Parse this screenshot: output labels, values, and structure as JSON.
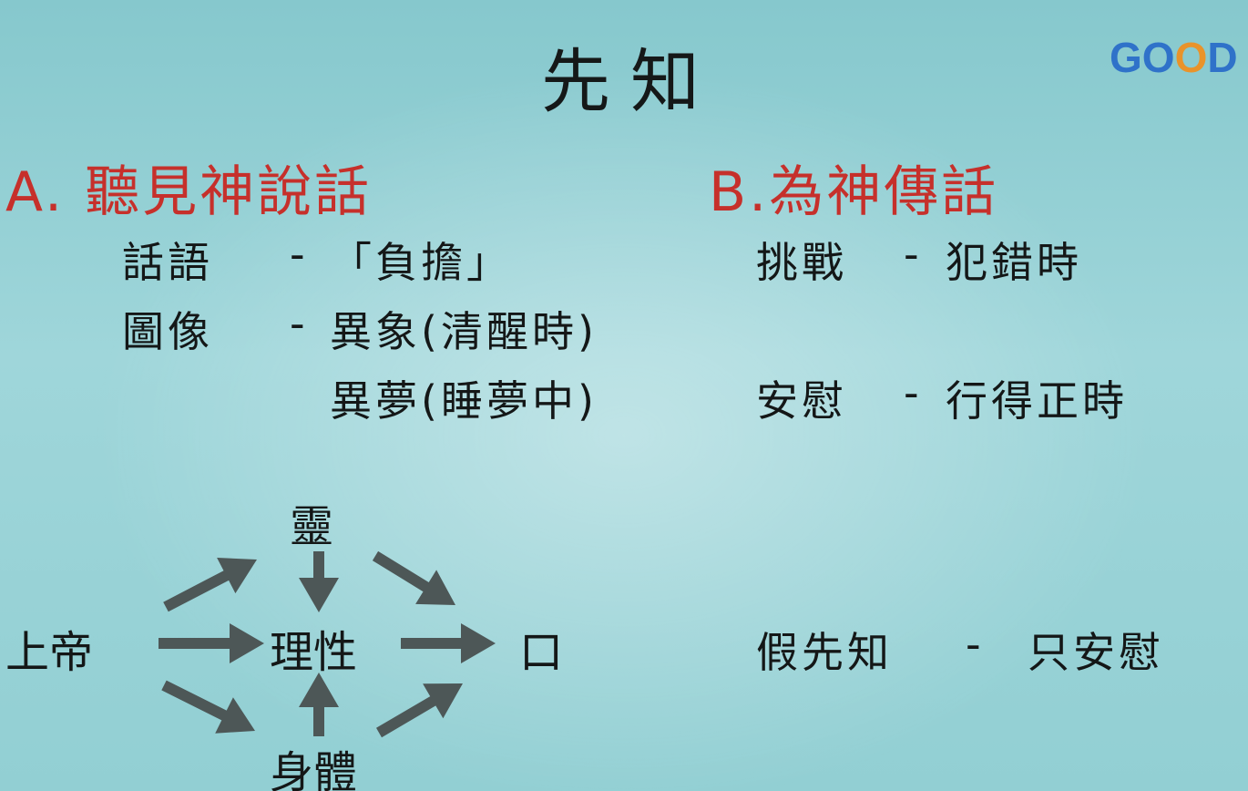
{
  "slide": {
    "title": "先知",
    "logo": {
      "g": "G",
      "o1": "O",
      "o2": "O",
      "d": "D"
    },
    "section_a": {
      "heading": "A. 聽見神說話",
      "row1": {
        "term": "話語",
        "dash": "-",
        "desc": "「負擔」"
      },
      "row2": {
        "term": "圖像",
        "dash": "-",
        "desc": "異象(清醒時)"
      },
      "row3": {
        "desc": "異夢(睡夢中)"
      }
    },
    "section_b": {
      "heading": "B.為神傳話",
      "row1": {
        "term": "挑戰",
        "dash": "-",
        "desc": "犯錯時"
      },
      "row2": {
        "term": "安慰",
        "dash": "-",
        "desc": "行得正時"
      },
      "row3": {
        "term": "假先知",
        "dash": "-",
        "desc": "只安慰"
      }
    },
    "diagram": {
      "spirit": "靈",
      "god": "上帝",
      "reason": "理性",
      "mouth": "口",
      "body": "身體",
      "arrow_color": "#4d5757"
    }
  }
}
